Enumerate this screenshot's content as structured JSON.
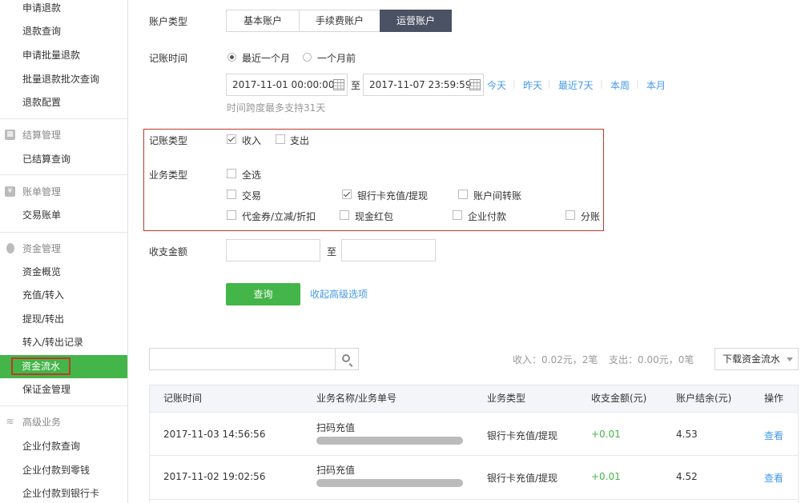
{
  "sidebar": {
    "items_top": [
      {
        "label": "申请退款"
      },
      {
        "label": "退款查询"
      },
      {
        "label": "申请批量退款"
      },
      {
        "label": "批量退款批次查询"
      },
      {
        "label": "退款配置"
      }
    ],
    "section_settlement": {
      "title": "结算管理",
      "items": [
        {
          "label": "已结算查询"
        }
      ]
    },
    "section_bill": {
      "title": "账单管理",
      "items": [
        {
          "label": "交易账单"
        }
      ]
    },
    "section_funds": {
      "title": "资金管理",
      "items": [
        {
          "label": "资金概览"
        },
        {
          "label": "充值/转入"
        },
        {
          "label": "提现/转出"
        },
        {
          "label": "转入/转出记录"
        },
        {
          "label": "资金流水",
          "active": true
        },
        {
          "label": "保证金管理"
        }
      ]
    },
    "section_advanced": {
      "title": "高级业务",
      "items": [
        {
          "label": "企业付款查询"
        },
        {
          "label": "企业付款到零钱"
        },
        {
          "label": "企业付款到银行卡"
        }
      ]
    }
  },
  "filters": {
    "account_type_label": "账户类型",
    "account_tabs": [
      {
        "label": "基本账户",
        "active": false
      },
      {
        "label": "手续费账户",
        "active": false
      },
      {
        "label": "运营账户",
        "active": true
      }
    ],
    "time_label": "记账时间",
    "time_options": [
      {
        "label": "最近一个月",
        "selected": true
      },
      {
        "label": "一个月前",
        "selected": false
      }
    ],
    "start_date": "2017-11-01 00:00:00",
    "range_to": "至",
    "end_date": "2017-11-07 23:59:59",
    "quick_ranges": [
      "今天",
      "昨天",
      "最近7天",
      "本周",
      "本月"
    ],
    "range_hint": "时间跨度最多支持31天",
    "entry_type_label": "记账类型",
    "entry_types": [
      {
        "label": "收入",
        "checked": true
      },
      {
        "label": "支出",
        "checked": false
      }
    ],
    "biz_type_label": "业务类型",
    "biz_types": [
      {
        "label": "全选",
        "checked": false
      },
      {
        "label": "交易",
        "checked": false
      },
      {
        "label": "银行卡充值/提现",
        "checked": true
      },
      {
        "label": "账户间转账",
        "checked": false
      },
      {
        "label": "代金券/立减/折扣",
        "checked": false
      },
      {
        "label": "现金红包",
        "checked": false
      },
      {
        "label": "企业付款",
        "checked": false
      },
      {
        "label": "分账",
        "checked": false
      }
    ],
    "amount_label": "收支金额",
    "amount_to": "至",
    "amount_min": "",
    "amount_max": "",
    "query_button": "查询",
    "collapse_link": "收起高级选项"
  },
  "results": {
    "search_value": "",
    "income_summary": "收入：0.02元，2笔",
    "expense_summary": "支出：0.00元，0笔",
    "download_button": "下载资金流水",
    "columns": [
      "记账时间",
      "业务名称/业务单号",
      "业务类型",
      "收支金额(元)",
      "账户结余(元)",
      "操作"
    ],
    "rows": [
      {
        "time": "2017-11-03 14:56:56",
        "biz_name": "扫码充值",
        "biz_type": "银行卡充值/提现",
        "amount": "+0.01",
        "balance": "4.53",
        "action": "查看"
      },
      {
        "time": "2017-11-02 19:02:56",
        "biz_name": "扫码充值",
        "biz_type": "银行卡充值/提现",
        "amount": "+0.01",
        "balance": "4.52",
        "action": "查看"
      }
    ]
  },
  "colors": {
    "brand_green": "#44b549",
    "link_blue": "#459ae9",
    "tab_active": "#4a5264",
    "highlight_red": "#c0392b"
  }
}
